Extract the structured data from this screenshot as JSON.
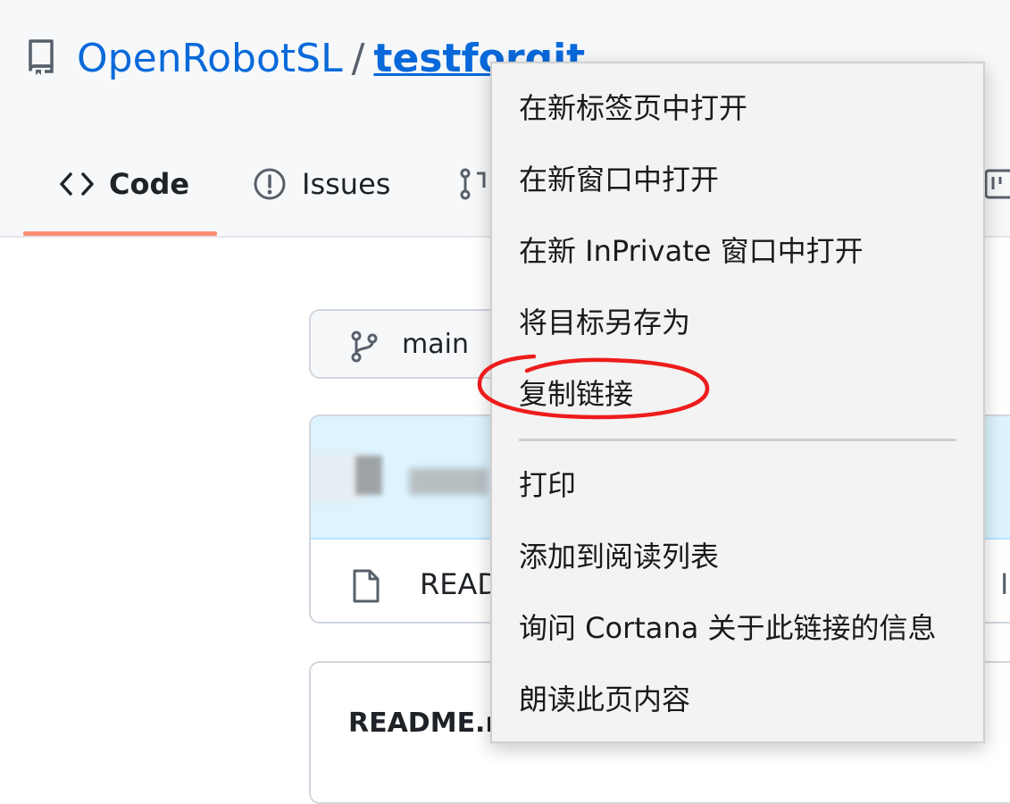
{
  "repo": {
    "owner": "OpenRobotSL",
    "separator": "/",
    "name": "testforgit"
  },
  "tabs": [
    {
      "label": "Code",
      "icon": "code-icon"
    },
    {
      "label": "Issues",
      "icon": "issue-opened-icon"
    },
    {
      "label": "",
      "icon": "git-pull-request-icon"
    },
    {
      "label": "",
      "icon": "project-icon"
    }
  ],
  "branch": {
    "label": "main",
    "icon": "git-branch-icon"
  },
  "files": {
    "row_name": "READ",
    "row_right": "I",
    "readme_title": "README.r"
  },
  "context_menu": {
    "items": [
      "在新标签页中打开",
      "在新窗口中打开",
      "在新 InPrivate 窗口中打开",
      "将目标另存为",
      "复制链接",
      "打印",
      "添加到阅读列表",
      "询问 Cortana 关于此链接的信息",
      "朗读此页内容"
    ],
    "highlighted_item": "复制链接"
  },
  "colors": {
    "link": "#0969da",
    "tab_underline": "#fd8c73",
    "annotation_ring": "#ee1c1c"
  }
}
